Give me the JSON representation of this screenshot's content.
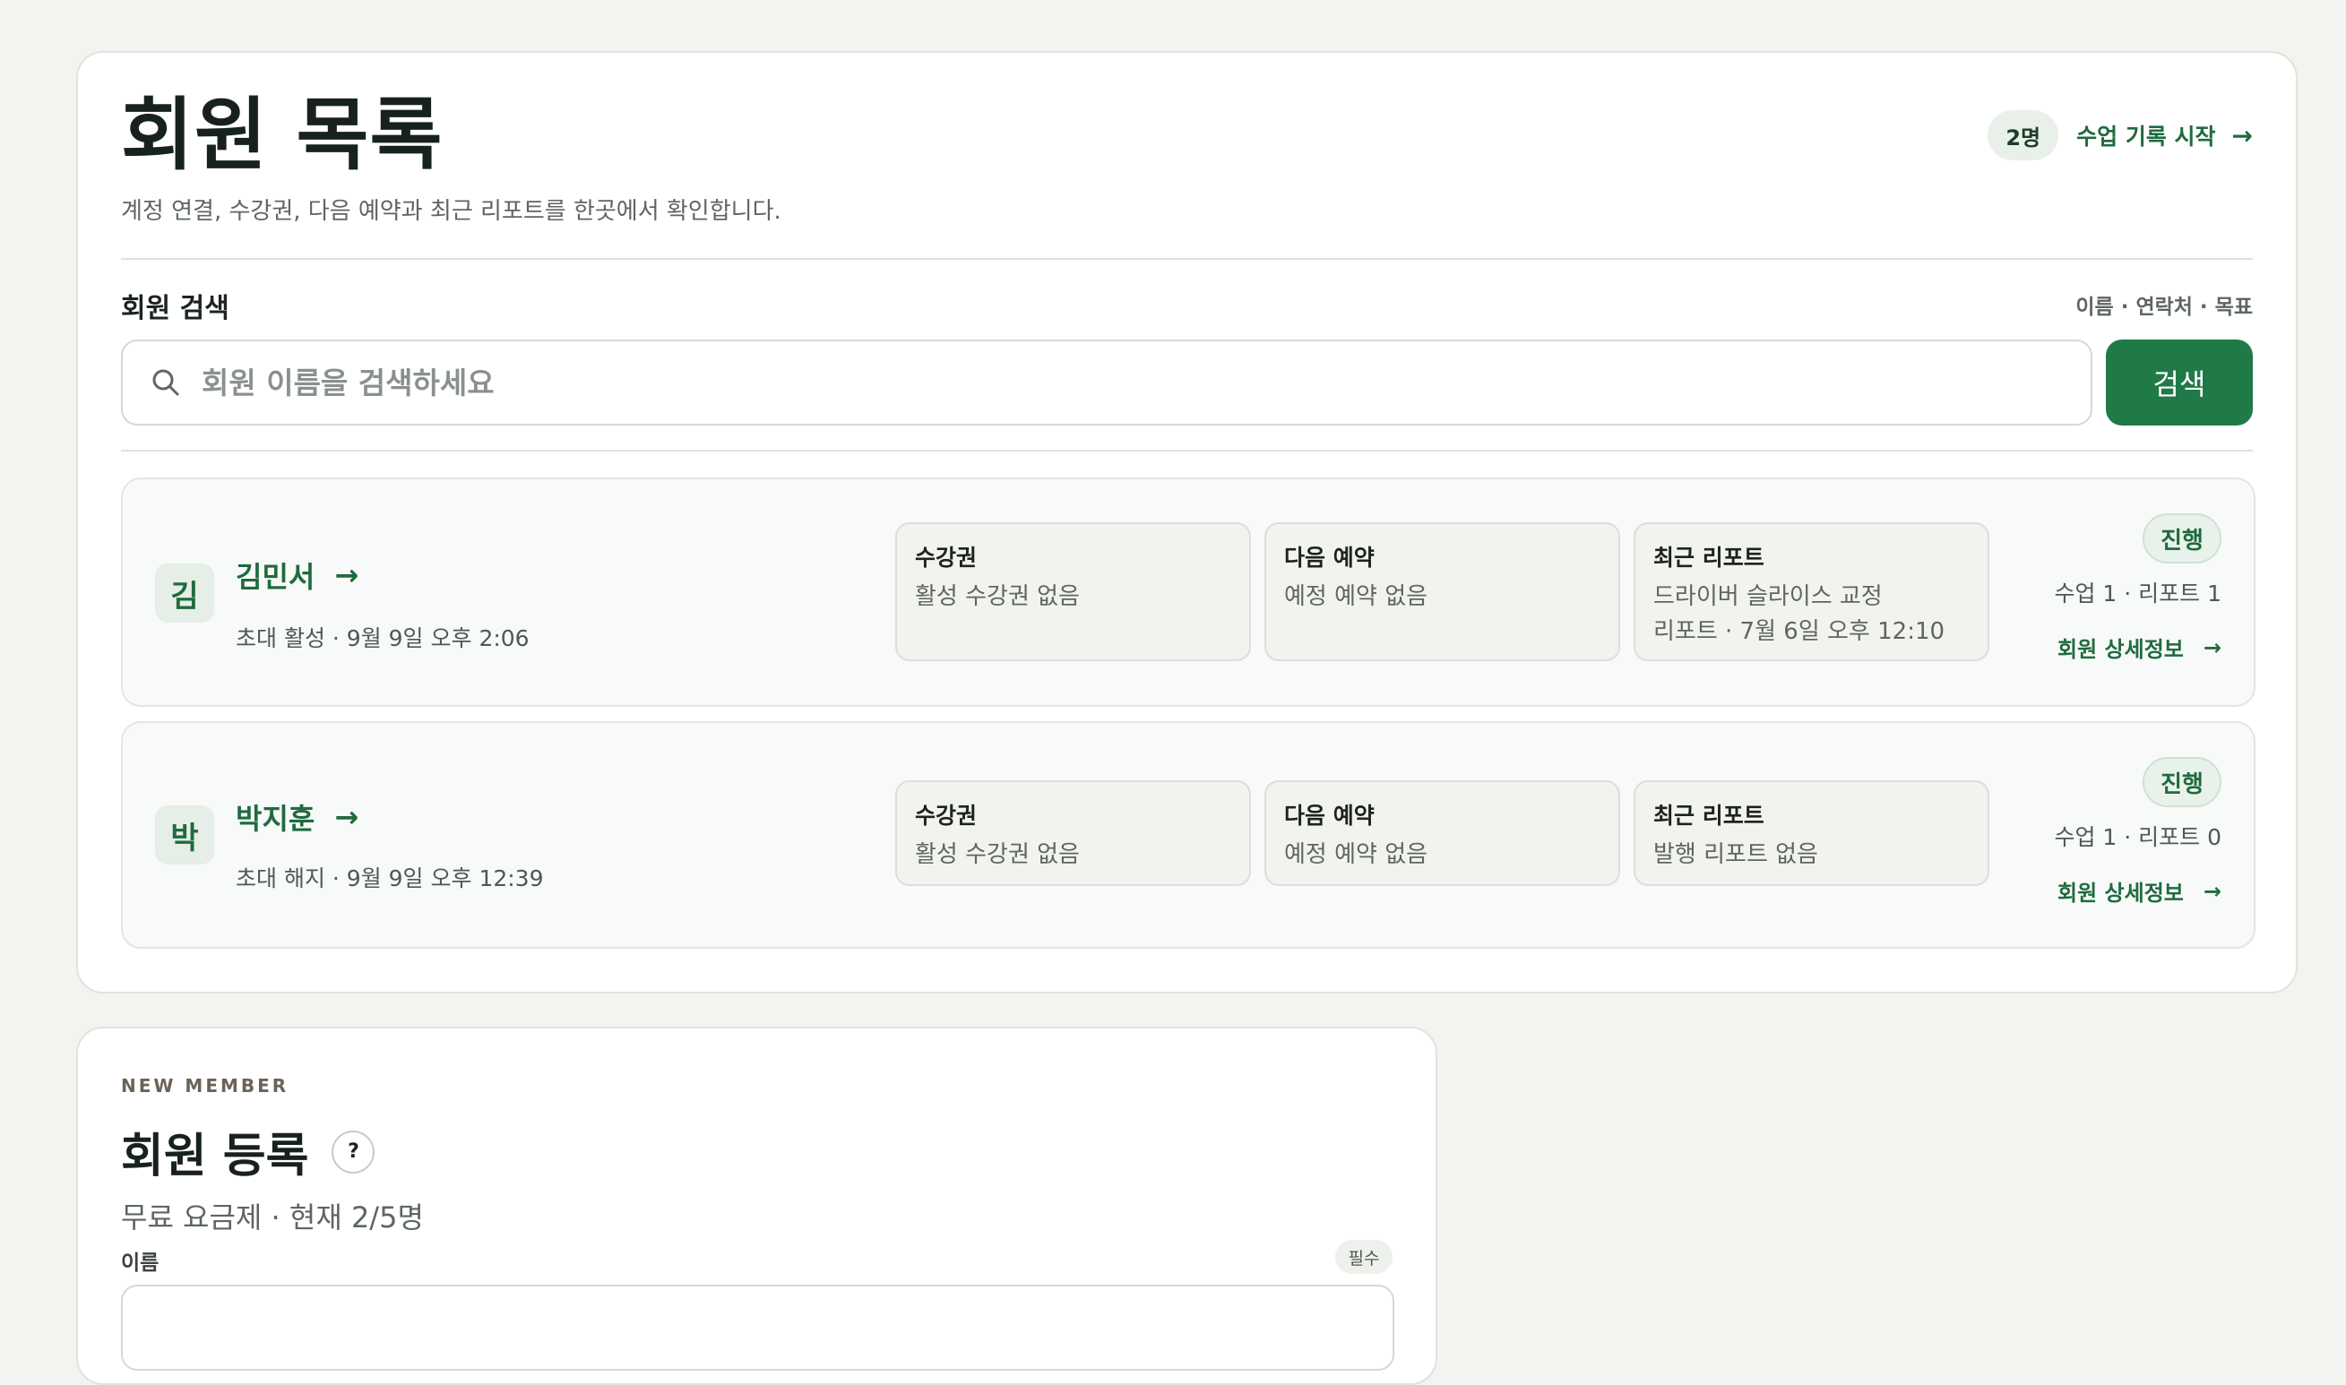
{
  "header": {
    "title": "회원 목록",
    "subtitle": "계정 연결, 수강권, 다음 예약과 최근 리포트를 한곳에서 확인합니다.",
    "member_count": "2명",
    "start_lesson_label": "수업 기록 시작",
    "arrow": "→"
  },
  "search": {
    "label": "회원 검색",
    "hint": "이름 · 연락처 · 목표",
    "placeholder": "회원 이름을 검색하세요",
    "value": "",
    "button_label": "검색"
  },
  "members": [
    {
      "initial": "김",
      "name": "김민서",
      "arrow": "→",
      "meta": "초대 활성 · 9월 9일 오후 2:06",
      "pass_title": "수강권",
      "pass_value": "활성 수강권 없음",
      "booking_title": "다음 예약",
      "booking_value": "예정 예약 없음",
      "report_title": "최근 리포트",
      "report_value_line1": "드라이버 슬라이스 교정",
      "report_value_line2": "리포트 · 7월 6일 오후 12:10",
      "status": "진행",
      "stats": "수업 1 · 리포트 1",
      "detail_label": "회원 상세정보",
      "detail_arrow": "→"
    },
    {
      "initial": "박",
      "name": "박지훈",
      "arrow": "→",
      "meta": "초대 해지 · 9월 9일 오후 12:39",
      "pass_title": "수강권",
      "pass_value": "활성 수강권 없음",
      "booking_title": "다음 예약",
      "booking_value": "예정 예약 없음",
      "report_title": "최근 리포트",
      "report_value_line1": "발행 리포트 없음",
      "status": "진행",
      "stats": "수업 1 · 리포트 0",
      "detail_label": "회원 상세정보",
      "detail_arrow": "→"
    }
  ],
  "new_member": {
    "eyebrow": "NEW MEMBER",
    "title": "회원 등록",
    "help_icon": "?",
    "plan": "무료 요금제 · 현재 2/5명",
    "name_label": "이름",
    "required": "필수",
    "name_value": ""
  },
  "colors": {
    "accent": "#1f7a47",
    "accent_text": "#1f6b3e",
    "background": "#f3f3ef"
  }
}
